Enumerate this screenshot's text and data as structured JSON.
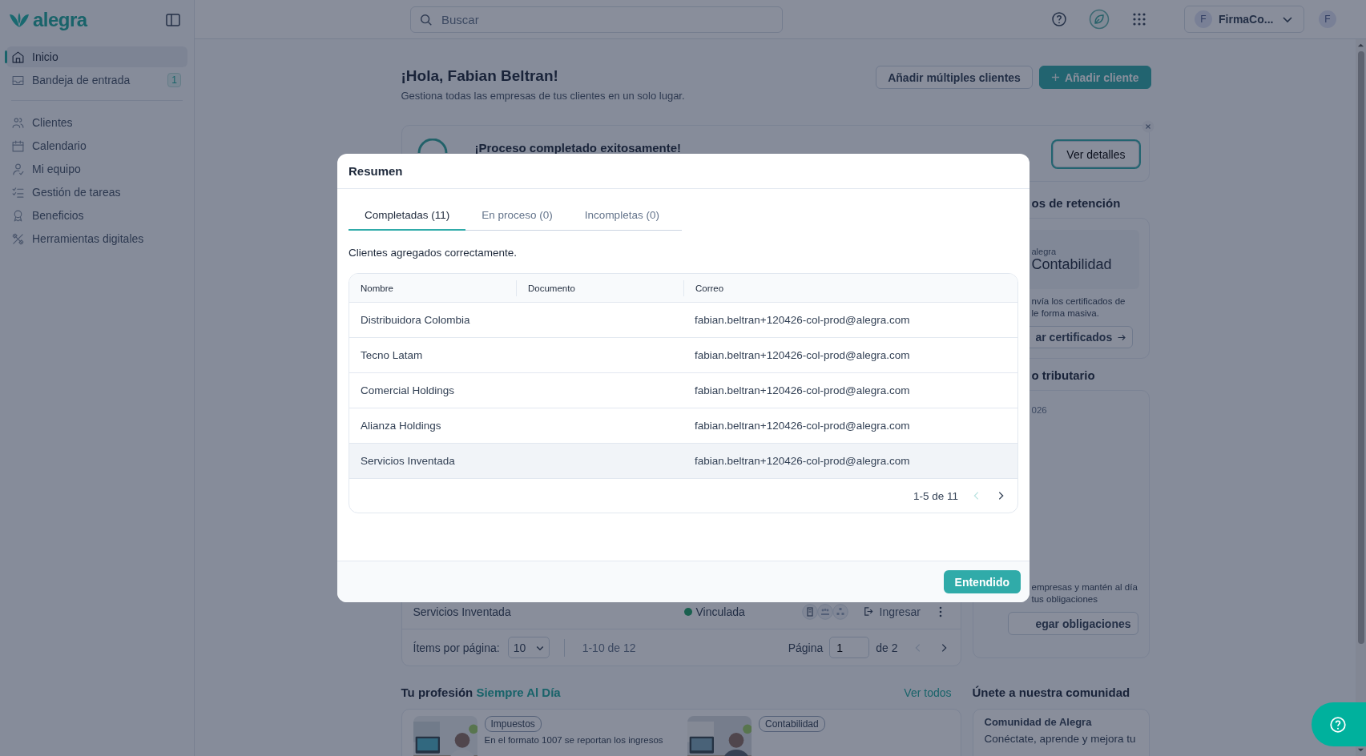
{
  "sidebar": {
    "logo": "alegra",
    "groups": [
      [
        {
          "label": "Inicio",
          "selected": true
        },
        {
          "label": "Bandeja de entrada",
          "selected": false,
          "badge": "1"
        }
      ],
      [
        {
          "label": "Clientes",
          "selected": false
        },
        {
          "label": "Calendario",
          "selected": false
        },
        {
          "label": "Mi equipo",
          "selected": false
        },
        {
          "label": "Gestión de tareas",
          "selected": false
        },
        {
          "label": "Beneficios",
          "selected": false
        },
        {
          "label": "Herramientas digitales",
          "selected": false
        }
      ]
    ]
  },
  "topbar": {
    "search": {
      "placeholder": "Buscar"
    },
    "account": {
      "initial": "F",
      "name": "FirmaCo..."
    },
    "avatar": "F"
  },
  "header": {
    "title": "¡Hola, Fabian Beltran!",
    "subtitle": "Gestiona todas las empresas de tus clientes en un solo lugar.",
    "buttons": [
      {
        "label": "Añadir múltiples clientes",
        "kind": "secondary"
      },
      {
        "label": "Añadir cliente",
        "kind": "primary"
      }
    ]
  },
  "banner": {
    "title": "¡Proceso completado exitosamente!",
    "button": "Ver detalles"
  },
  "retention": {
    "heading": "os de retención",
    "logo_small": "alegra",
    "logo_name": "Contabilidad",
    "text_lines": [
      "nvía los certificados de",
      "le forma masiva."
    ],
    "button": "ar certificados"
  },
  "tax": {
    "heading": "o tributario",
    "date": "026",
    "text_lines": [
      "empresas y mantén al día",
      "tus obligaciones"
    ],
    "button": "egar obligaciones"
  },
  "clients_table": {
    "row": {
      "name": "Servicios Inventada",
      "status": "Vinculada",
      "action": "Ingresar"
    },
    "footer": {
      "per_page_label": "Ítems por página:",
      "per_page": "10",
      "range": "1-10 de 12",
      "page_label": "Página",
      "page": "1",
      "page_total": "de 2",
      "prev_disabled": true
    }
  },
  "profession": {
    "heading": "Tu profesión",
    "highlight": "Siempre Al Día",
    "link": "Ver todos",
    "articles": [
      {
        "tag": "Impuestos",
        "text": "En el formato 1007 se reportan los ingresos"
      },
      {
        "tag": "Contabilidad"
      }
    ]
  },
  "community": {
    "heading": "Únete a nuestra comunidad",
    "title": "Comunidad de Alegra",
    "text": "Conéctate, aprende y mejora tu"
  },
  "modal": {
    "title": "Resumen",
    "tabs": [
      {
        "label": "Completadas (11)",
        "selected": true
      },
      {
        "label": "En proceso (0)",
        "selected": false
      },
      {
        "label": "Incompletas (0)",
        "selected": false
      }
    ],
    "message": "Clientes agregados correctamente.",
    "columns": [
      "Nombre",
      "Documento",
      "Correo"
    ],
    "rows": [
      {
        "name": "Distribuidora Colombia",
        "email": "fabian.beltran+120426-col-prod@alegra.com",
        "highlighted": false
      },
      {
        "name": "Tecno Latam",
        "email": "fabian.beltran+120426-col-prod@alegra.com",
        "highlighted": false
      },
      {
        "name": "Comercial Holdings",
        "email": "fabian.beltran+120426-col-prod@alegra.com",
        "highlighted": false
      },
      {
        "name": "Alianza Holdings",
        "email": "fabian.beltran+120426-col-prod@alegra.com",
        "highlighted": false
      },
      {
        "name": "Servicios Inventada",
        "email": "fabian.beltran+120426-col-prod@alegra.com",
        "highlighted": true
      }
    ],
    "pager": {
      "range": "1-5 de 11",
      "prev_disabled": true
    },
    "button": "Entendido"
  }
}
